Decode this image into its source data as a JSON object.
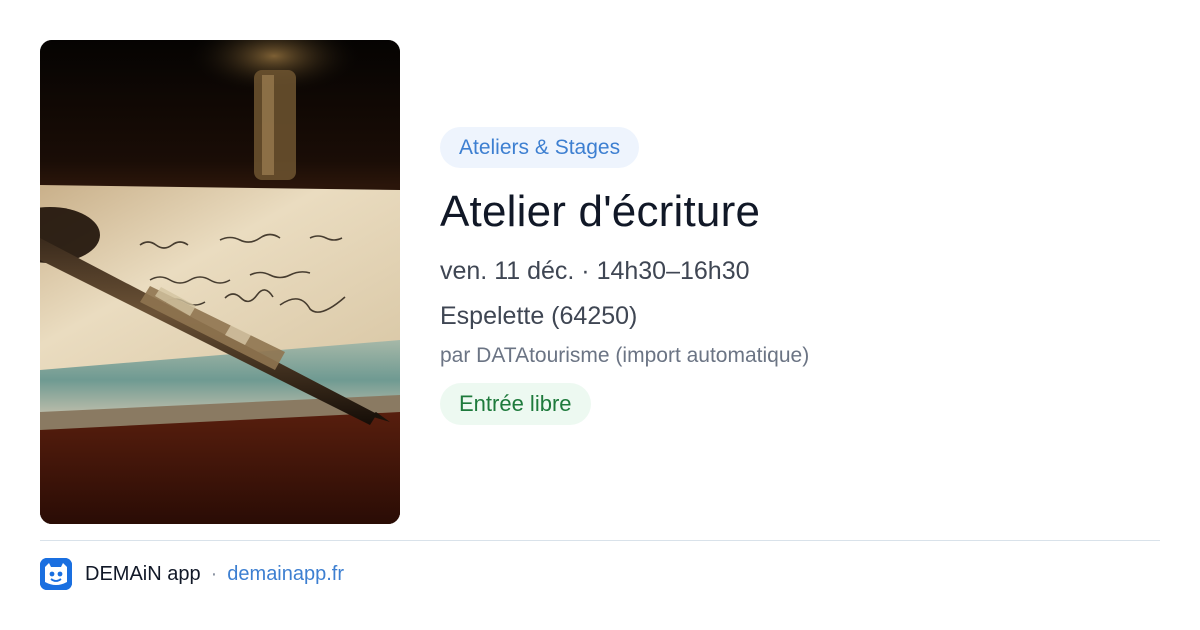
{
  "event": {
    "category": "Ateliers & Stages",
    "title": "Atelier d'écriture",
    "datetime": "ven. 11 déc. · 14h30–16h30",
    "location": "Espelette (64250)",
    "source": "par DATAtourisme (import automatique)",
    "price": "Entrée libre",
    "image_subject": "fountain pen resting on a handwritten letter"
  },
  "footer": {
    "app_name": "DEMAiN app",
    "separator": "·",
    "url": "demainapp.fr",
    "logo_icon": "demain-app-logo-icon"
  },
  "colors": {
    "category_badge_bg": "#eef4fd",
    "category_badge_text": "#3d7fd1",
    "price_badge_bg": "#edf9f1",
    "price_badge_text": "#1e7a3c",
    "link": "#3d7fd1",
    "logo_bg": "#1a6fe0"
  }
}
